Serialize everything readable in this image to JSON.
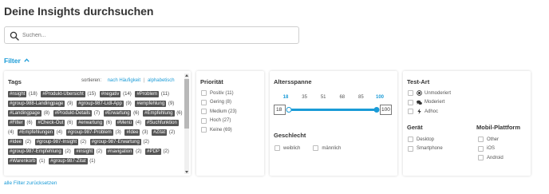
{
  "page": {
    "title": "Deine Insights durchsuchen",
    "accent_color": "#1a9bd7",
    "tag_color": "#555555"
  },
  "search": {
    "placeholder": "Suchen...",
    "value": "",
    "icon": "search-icon"
  },
  "filter": {
    "toggle_label": "Filter",
    "toggle_icon": "chevron-up-icon",
    "reset_label": "alle Filter zurücksetzen"
  },
  "tags": {
    "title": "Tags",
    "sort_label": "sortieren:",
    "sort_frequency": "nach Häufigkeit",
    "sort_separator": "|",
    "sort_alpha": "alphabetisch",
    "items": [
      {
        "label": "#nsight",
        "count": "(18)"
      },
      {
        "label": "#Produkt-Übersicht",
        "count": "(15)"
      },
      {
        "label": "#negativ",
        "count": "(14)"
      },
      {
        "label": "#Problem",
        "count": "(11)"
      },
      {
        "label": "#group-988-Landingpage",
        "count": "(9)"
      },
      {
        "label": "#group-987-Lidl-App",
        "count": "(9)"
      },
      {
        "label": "#empfehlung",
        "count": "(9)"
      },
      {
        "label": "#Landingpage",
        "count": "(8)"
      },
      {
        "label": "#Produkt-Details",
        "count": "(7)"
      },
      {
        "label": "#Erwartung",
        "count": "(6)"
      },
      {
        "label": "#Empfehlung",
        "count": "(6)"
      },
      {
        "label": "#Filter",
        "count": "(6)"
      },
      {
        "label": "#Check-Out",
        "count": "(6)"
      },
      {
        "label": "#erwartung",
        "count": "(6)"
      },
      {
        "label": "#Menü",
        "count": "(4)"
      },
      {
        "label": "#Suchfunktion",
        "count": "(4)"
      },
      {
        "label": "#Empfehlungen",
        "count": "(4)"
      },
      {
        "label": "#group-987-Problem",
        "count": "(3)"
      },
      {
        "label": "#Idee",
        "count": "(3)"
      },
      {
        "label": "#Zitat",
        "count": "(2)"
      },
      {
        "label": "#Idee",
        "count": "(2)"
      },
      {
        "label": "#group-987-Insight",
        "count": "(2)"
      },
      {
        "label": "#group-987-Erwartung",
        "count": "(2)"
      },
      {
        "label": "#group-987-Empfehlung",
        "count": "(2)"
      },
      {
        "label": "#insight",
        "count": "(2)"
      },
      {
        "label": "#navigation",
        "count": "(2)"
      },
      {
        "label": "#PDP",
        "count": "(2)"
      },
      {
        "label": "#Warenkorb",
        "count": "(1)"
      },
      {
        "label": "#group-987-Zitat",
        "count": "(1)"
      }
    ]
  },
  "priority": {
    "title": "Priorität",
    "options": [
      {
        "label": "Positiv (11)",
        "checked": false
      },
      {
        "label": "Gering (8)",
        "checked": false
      },
      {
        "label": "Medium (23)",
        "checked": false
      },
      {
        "label": "Hoch (27)",
        "checked": false
      },
      {
        "label": "Keine (69)",
        "checked": false
      }
    ]
  },
  "age": {
    "title": "Altersspanne",
    "ticks": [
      "18",
      "35",
      "51",
      "68",
      "85",
      "100"
    ],
    "min_value": "18",
    "max_value": "100",
    "range_min": 18,
    "range_max": 100
  },
  "gender": {
    "title": "Geschlecht",
    "options": [
      {
        "label": "weiblich",
        "checked": false
      },
      {
        "label": "männlich",
        "checked": false
      }
    ]
  },
  "test_type": {
    "title": "Test-Art",
    "options": [
      {
        "label": "Unmoderiert",
        "icon": "record-icon",
        "checked": false
      },
      {
        "label": "Moderiert",
        "icon": "chat-bubbles-icon",
        "checked": false
      },
      {
        "label": "Adhoc",
        "icon": "lightning-icon",
        "checked": false
      }
    ]
  },
  "device": {
    "title": "Gerät",
    "options": [
      {
        "label": "Desktop",
        "checked": false
      },
      {
        "label": "Smartphone",
        "checked": false
      }
    ]
  },
  "mobile_platform": {
    "title": "Mobil-Plattform",
    "options": [
      {
        "label": "Other",
        "checked": false
      },
      {
        "label": "iOS",
        "checked": false
      },
      {
        "label": "Android",
        "checked": false
      }
    ]
  }
}
